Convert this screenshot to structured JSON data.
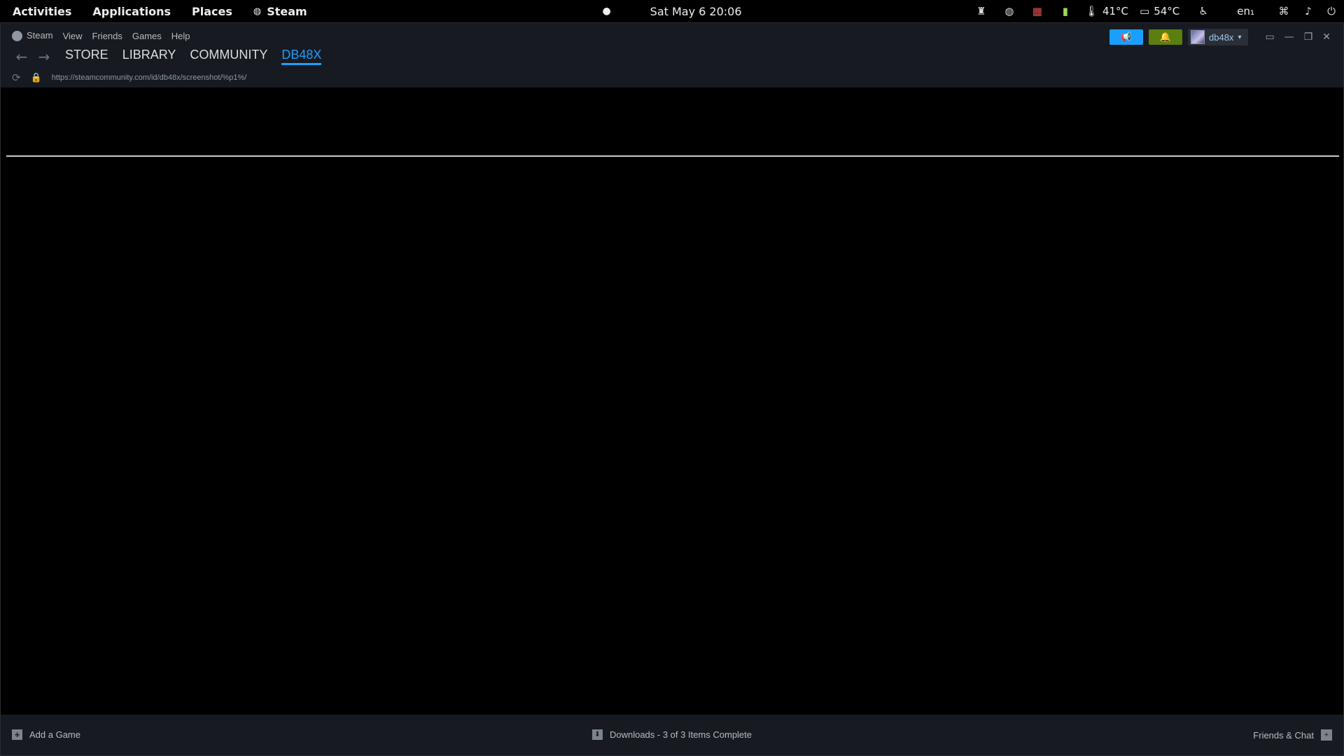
{
  "topbar": {
    "activities": "Activities",
    "applications": "Applications",
    "places": "Places",
    "steam": "Steam",
    "datetime": "Sat May 6  20:06",
    "temp_cpu": "41°C",
    "temp_gpu": "54°C",
    "lang": "en₁"
  },
  "steam": {
    "menu": [
      "Steam",
      "View",
      "Friends",
      "Games",
      "Help"
    ],
    "tabs": [
      "STORE",
      "LIBRARY",
      "COMMUNITY",
      "DB48X"
    ],
    "active_tab": "DB48X",
    "url": "https://steamcommunity.com/id/db48x/screenshot/%p1%/",
    "username": "db48x",
    "colors": {
      "accent": "#1a9fff",
      "notify": "#5c7e10",
      "bar": "#171a21"
    }
  },
  "bottom": {
    "add_game": "Add a Game",
    "downloads": "Downloads - 3 of 3 Items Complete",
    "friends_chat": "Friends & Chat"
  }
}
